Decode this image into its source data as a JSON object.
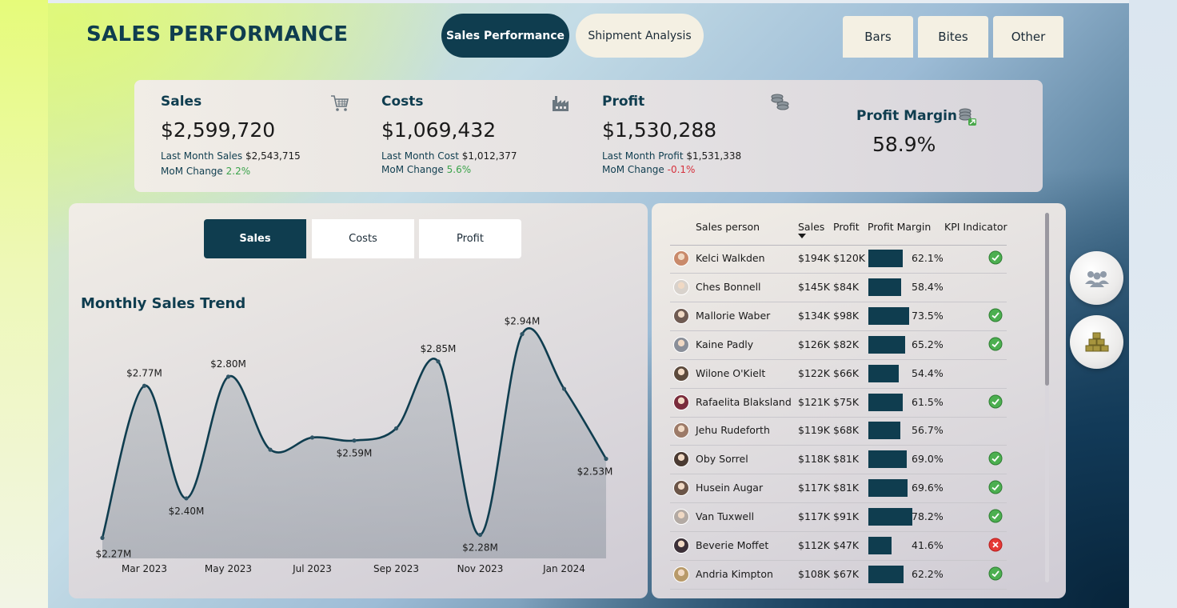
{
  "header": {
    "title": "SALES PERFORMANCE",
    "nav_pills": [
      "Sales Performance",
      "Shipment Analysis"
    ],
    "active_pill": "Sales Performance",
    "right_tabs": [
      "Bars",
      "Bites",
      "Other"
    ]
  },
  "kpis": {
    "sales": {
      "label": "Sales",
      "value": "$2,599,720",
      "last_label": "Last Month Sales",
      "last_value": "$2,543,715",
      "mom_label": "MoM Change",
      "mom_value": "2.2%",
      "icon": "shopping-cart-icon"
    },
    "costs": {
      "label": "Costs",
      "value": "$1,069,432",
      "last_label": "Last Month Cost",
      "last_value": "$1,012,377",
      "mom_label": "MoM Change",
      "mom_value": "5.6%",
      "icon": "factory-icon"
    },
    "profit": {
      "label": "Profit",
      "value": "$1,530,288",
      "last_label": "Last Month Profit",
      "last_value": "$1,531,338",
      "mom_label": "MoM Change",
      "mom_value": "-0.1%",
      "icon": "coins-icon"
    },
    "margin": {
      "label": "Profit Margin",
      "value": "58.9%",
      "icon": "coins-up-icon"
    }
  },
  "chart_tabs": [
    "Sales",
    "Costs",
    "Profit"
  ],
  "active_chart_tab": "Sales",
  "chart_data": {
    "type": "area",
    "title": "Monthly Sales Trend",
    "x": [
      "Feb 2023",
      "Mar 2023",
      "Apr 2023",
      "May 2023",
      "Jun 2023",
      "Jul 2023",
      "Aug 2023",
      "Sep 2023",
      "Oct 2023",
      "Nov 2023",
      "Dec 2023",
      "Jan 2024",
      "Feb 2024"
    ],
    "x_tick_labels": [
      "Mar 2023",
      "May 2023",
      "Jul 2023",
      "Sep 2023",
      "Nov 2023",
      "Jan 2024"
    ],
    "values": [
      2.27,
      2.77,
      2.4,
      2.8,
      2.56,
      2.6,
      2.59,
      2.63,
      2.85,
      2.28,
      2.94,
      2.76,
      2.53
    ],
    "data_labels": [
      {
        "index": 0,
        "text": "$2.27M"
      },
      {
        "index": 1,
        "text": "$2.77M"
      },
      {
        "index": 2,
        "text": "$2.40M"
      },
      {
        "index": 3,
        "text": "$2.80M"
      },
      {
        "index": 6,
        "text": "$2.59M"
      },
      {
        "index": 8,
        "text": "$2.85M"
      },
      {
        "index": 9,
        "text": "$2.28M"
      },
      {
        "index": 10,
        "text": "$2.94M"
      },
      {
        "index": 12,
        "text": "$2.53M"
      }
    ],
    "unit": "$M",
    "color": "#0f3d4f",
    "grid": false
  },
  "table": {
    "columns": [
      "Sales person",
      "Sales",
      "Profit",
      "Profit Margin",
      "KPI Indicator"
    ],
    "sort_column": "Sales",
    "rows": [
      {
        "name": "Kelci Walkden",
        "sales": "$194K",
        "profit": "$120K",
        "margin": 62.1,
        "margin_text": "62.1%",
        "kpi": "ok",
        "avatar": "#c98a6b"
      },
      {
        "name": "Ches Bonnell",
        "sales": "$145K",
        "profit": "$84K",
        "margin": 58.4,
        "margin_text": "58.4%",
        "kpi": "none",
        "avatar": "#d8d2cc"
      },
      {
        "name": "Mallorie Waber",
        "sales": "$134K",
        "profit": "$98K",
        "margin": 73.5,
        "margin_text": "73.5%",
        "kpi": "ok",
        "avatar": "#6f5b52"
      },
      {
        "name": "Kaine Padly",
        "sales": "$126K",
        "profit": "$82K",
        "margin": 65.2,
        "margin_text": "65.2%",
        "kpi": "ok",
        "avatar": "#8a8f99"
      },
      {
        "name": "Wilone O'Kielt",
        "sales": "$122K",
        "profit": "$66K",
        "margin": 54.4,
        "margin_text": "54.4%",
        "kpi": "none",
        "avatar": "#5c4a3c"
      },
      {
        "name": "Rafaelita Blaksland",
        "sales": "$121K",
        "profit": "$75K",
        "margin": 61.5,
        "margin_text": "61.5%",
        "kpi": "ok",
        "avatar": "#7a2c3c"
      },
      {
        "name": "Jehu Rudeforth",
        "sales": "$119K",
        "profit": "$68K",
        "margin": 56.7,
        "margin_text": "56.7%",
        "kpi": "none",
        "avatar": "#9c7a68"
      },
      {
        "name": "Oby Sorrel",
        "sales": "$118K",
        "profit": "$81K",
        "margin": 69.0,
        "margin_text": "69.0%",
        "kpi": "ok",
        "avatar": "#4a3a32"
      },
      {
        "name": "Husein Augar",
        "sales": "$117K",
        "profit": "$81K",
        "margin": 69.6,
        "margin_text": "69.6%",
        "kpi": "ok",
        "avatar": "#6b5548"
      },
      {
        "name": "Van Tuxwell",
        "sales": "$117K",
        "profit": "$91K",
        "margin": 78.2,
        "margin_text": "78.2%",
        "kpi": "ok",
        "avatar": "#b3aaa4"
      },
      {
        "name": "Beverie Moffet",
        "sales": "$112K",
        "profit": "$47K",
        "margin": 41.6,
        "margin_text": "41.6%",
        "kpi": "bad",
        "avatar": "#3c3038"
      },
      {
        "name": "Andria Kimpton",
        "sales": "$108K",
        "profit": "$67K",
        "margin": 62.2,
        "margin_text": "62.2%",
        "kpi": "ok",
        "avatar": "#b89a6a"
      }
    ]
  },
  "side_buttons": [
    {
      "icon": "people-icon"
    },
    {
      "icon": "stacked-boxes-icon"
    }
  ],
  "colors": {
    "primary": "#0f3d4f",
    "positive": "#3aa34a",
    "negative": "#d6303c",
    "kpi_ok": "#4caf50",
    "kpi_bad": "#e53935"
  }
}
